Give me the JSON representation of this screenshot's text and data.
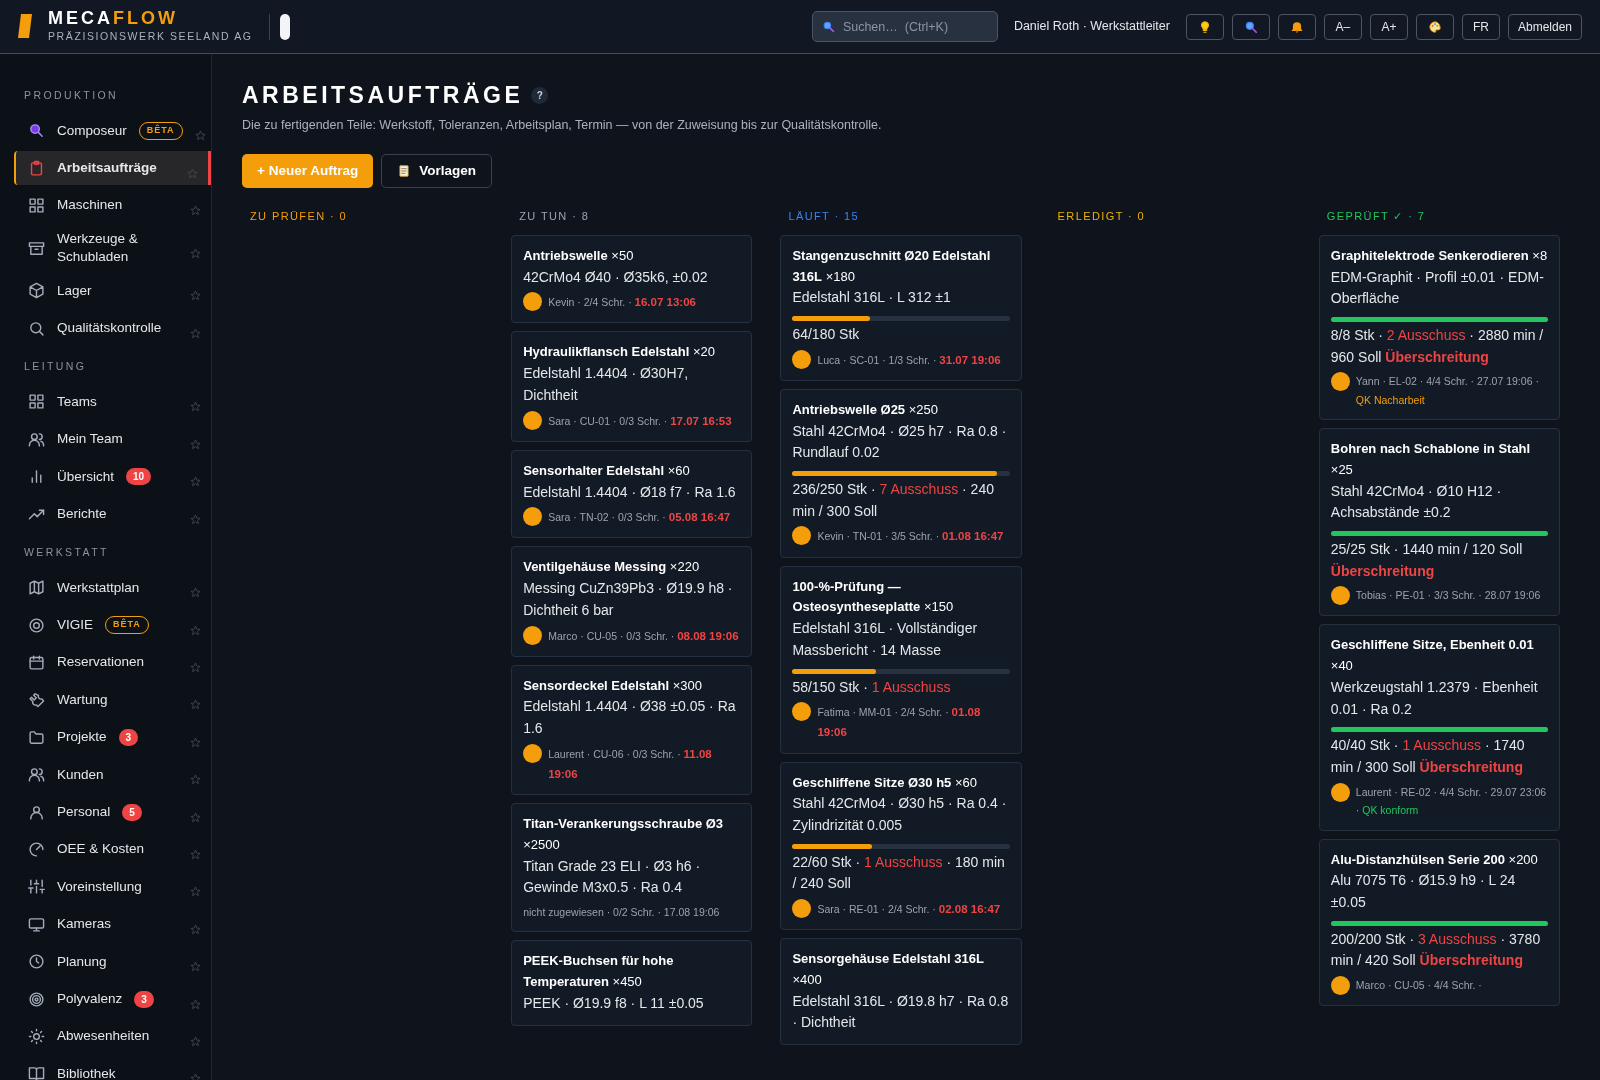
{
  "brand": {
    "first": "MECA",
    "second": "FLOW",
    "subtitle": "PRÄZISIONSWERK SEELAND AG"
  },
  "header": {
    "search": {
      "placeholder": "Suchen…  (Ctrl+K)"
    },
    "user": "Daniel Roth · Werkstattleiter",
    "text_buttons": [
      "A–",
      "A+",
      "FR",
      "Abmelden"
    ]
  },
  "sidebar": [
    {
      "title": "PRODUKTION",
      "items": [
        {
          "label": "Composeur",
          "selected": false,
          "badge": {
            "kind": "beta",
            "text": "BÊTA"
          }
        },
        {
          "label": "Arbeitsaufträge",
          "selected": true
        },
        {
          "label": "Maschinen",
          "selected": false
        },
        {
          "label": "Werkzeuge & Schubladen",
          "selected": false
        },
        {
          "label": "Lager",
          "selected": false
        },
        {
          "label": "Qualitätskontrolle",
          "selected": false
        }
      ]
    },
    {
      "title": "LEITUNG",
      "items": [
        {
          "label": "Teams",
          "selected": false
        },
        {
          "label": "Mein Team",
          "selected": false
        },
        {
          "label": "Übersicht",
          "selected": false,
          "badge": {
            "kind": "count",
            "text": "10"
          }
        },
        {
          "label": "Berichte",
          "selected": false
        }
      ]
    },
    {
      "title": "WERKSTATT",
      "items": [
        {
          "label": "Werkstattplan",
          "selected": false
        },
        {
          "label": "VIGIE",
          "selected": false,
          "badge": {
            "kind": "beta",
            "text": "BÊTA"
          }
        },
        {
          "label": "Reservationen",
          "selected": false
        },
        {
          "label": "Wartung",
          "selected": false
        },
        {
          "label": "Projekte",
          "selected": false,
          "badge": {
            "kind": "count",
            "text": "3"
          }
        },
        {
          "label": "Kunden",
          "selected": false
        },
        {
          "label": "Personal",
          "selected": false,
          "badge": {
            "kind": "count",
            "text": "5"
          }
        },
        {
          "label": "OEE & Kosten",
          "selected": false
        },
        {
          "label": "Voreinstellung",
          "selected": false
        },
        {
          "label": "Kameras",
          "selected": false
        },
        {
          "label": "Planung",
          "selected": false
        },
        {
          "label": "Polyvalenz",
          "selected": false,
          "badge": {
            "kind": "count",
            "text": "3"
          }
        },
        {
          "label": "Abwesenheiten",
          "selected": false
        },
        {
          "label": "Bibliothek",
          "selected": false
        }
      ]
    }
  ],
  "page": {
    "title": "ARBEITSAUFTRÄGE",
    "help": "?",
    "subtitle": "Die zu fertigenden Teile: Werkstoff, Toleranzen, Arbeitsplan, Termin — von der Zuweisung bis zur Qualitätskontrolle.",
    "primary_button": "+ Neuer Auftrag",
    "secondary_button": "Vorlagen"
  },
  "columns": [
    {
      "label": "ZU PRÜFEN · 0",
      "color": "#f59e0b"
    },
    {
      "label": "ZU TUN · 8",
      "color": "#9ca3af",
      "cards": [
        {
          "title": "**Antriebswelle** ×50",
          "spec": "42CrMo4 Ø40 · Ø35k6, ±0.02",
          "assigned": true,
          "meta": [
            {
              "kind": "plain",
              "text": "Kevin · 2/4 Schr. · "
            },
            {
              "kind": "overdue",
              "text": "16.07 13:06"
            }
          ]
        },
        {
          "title": "**Hydraulikflansch Edelstahl** ×20",
          "spec": "Edelstahl 1.4404 · Ø30H7, Dichtheit",
          "assigned": true,
          "meta": [
            {
              "kind": "plain",
              "text": "Sara · CU-01 · 0/3 Schr. · "
            },
            {
              "kind": "overdue",
              "text": "17.07 16:53"
            }
          ]
        },
        {
          "title": "**Sensorhalter Edelstahl** ×60",
          "spec": "Edelstahl 1.4404 · Ø18 f7 · Ra 1.6",
          "assigned": true,
          "meta": [
            {
              "kind": "plain",
              "text": "Sara · TN-02 · 0/3 Schr. · "
            },
            {
              "kind": "overdue",
              "text": "05.08 16:47"
            }
          ]
        },
        {
          "title": "**Ventilgehäuse Messing** ×220",
          "spec": "Messing CuZn39Pb3 · Ø19.9 h8 · Dichtheit 6 bar",
          "assigned": true,
          "meta": [
            {
              "kind": "plain",
              "text": "Marco · CU-05 · 0/3 Schr. · "
            },
            {
              "kind": "overdue",
              "text": "08.08 19:06"
            }
          ]
        },
        {
          "title": "**Sensordeckel Edelstahl** ×300",
          "spec": "Edelstahl 1.4404 · Ø38 ±0.05 · Ra 1.6",
          "assigned": true,
          "meta": [
            {
              "kind": "plain",
              "text": "Laurent · CU-06 · 0/3 Schr. · "
            },
            {
              "kind": "overdue",
              "text": "11.08 19:06"
            }
          ]
        },
        {
          "title": "**Titan-Verankerungsschraube Ø3** ×2500",
          "spec": "Titan Grade 23 ELI · Ø3 h6 · Gewinde M3x0.5 · Ra 0.4",
          "assigned": false,
          "meta": [
            {
              "kind": "plain",
              "text": "nicht zugewiesen · 0/2 Schr. · "
            },
            {
              "kind": "date",
              "text": "17.08 19:06"
            }
          ]
        },
        {
          "title": "**PEEK-Buchsen für hohe Temperaturen** ×450",
          "spec": "PEEK · Ø19.9 f8 · L 11 ±0.05"
        }
      ]
    },
    {
      "label": "LÄUFT · 15",
      "color": "#3b82f6",
      "cards": [
        {
          "title": "**Stangenzuschnitt Ø20 Edelstahl 316L** ×180",
          "spec": "Edelstahl 316L · L 312 ±1",
          "progress": {
            "level": 0.356,
            "done": false
          },
          "stats": [
            {
              "kind": "plain",
              "text": "64/180 Stk"
            }
          ],
          "assigned": true,
          "meta": [
            {
              "kind": "plain",
              "text": "Luca · SC-01 · 1/3 Schr. · "
            },
            {
              "kind": "overdue",
              "text": "31.07 19:06"
            }
          ]
        },
        {
          "title": "**Antriebswelle Ø25** ×250",
          "spec": "Stahl 42CrMo4 · Ø25 h7 · Ra 0.8 · Rundlauf 0.02",
          "progress": {
            "level": 0.944,
            "done": false
          },
          "stats": [
            {
              "kind": "plain",
              "text": "236/250 Stk · "
            },
            {
              "kind": "scrap",
              "text": "7 Ausschuss"
            },
            {
              "kind": "plain",
              "text": " · 240 min / 300 Soll"
            }
          ],
          "assigned": true,
          "meta": [
            {
              "kind": "plain",
              "text": "Kevin · TN-01 · 3/5 Schr. · "
            },
            {
              "kind": "overdue",
              "text": "01.08 16:47"
            }
          ]
        },
        {
          "title": "**100-%-Prüfung — Osteosyntheseplatte** ×150",
          "spec": "Edelstahl 316L · Vollständiger Massbericht · 14 Masse",
          "progress": {
            "level": 0.387,
            "done": false
          },
          "stats": [
            {
              "kind": "plain",
              "text": "58/150 Stk · "
            },
            {
              "kind": "scrap",
              "text": "1 Ausschuss"
            }
          ],
          "assigned": true,
          "meta": [
            {
              "kind": "plain",
              "text": "Fatima · MM-01 · 2/4 Schr. · "
            },
            {
              "kind": "overdue",
              "text": "01.08 19:06"
            }
          ]
        },
        {
          "title": "**Geschliffene Sitze Ø30 h5** ×60",
          "spec": "Stahl 42CrMo4 · Ø30 h5 · Ra 0.4 · Zylindrizität 0.005",
          "progress": {
            "level": 0.367,
            "done": false
          },
          "stats": [
            {
              "kind": "plain",
              "text": "22/60 Stk · "
            },
            {
              "kind": "scrap",
              "text": "1 Ausschuss"
            },
            {
              "kind": "plain",
              "text": " · 180 min / 240 Soll"
            }
          ],
          "assigned": true,
          "meta": [
            {
              "kind": "plain",
              "text": "Sara · RE-01 · 2/4 Schr. · "
            },
            {
              "kind": "overdue",
              "text": "02.08 16:47"
            }
          ]
        },
        {
          "title": "**Sensorgehäuse Edelstahl 316L** ×400",
          "spec": "Edelstahl 316L · Ø19.8 h7 · Ra 0.8 · Dichtheit"
        }
      ]
    },
    {
      "label": "ERLEDIGT · 0",
      "color": "#eab308"
    },
    {
      "label": "GEPRÜFT ✓ · 7",
      "color": "#22c55e",
      "cards": [
        {
          "title": "**Graphitelektrode Senkerodieren** ×8",
          "spec": "EDM-Graphit · Profil ±0.01 · EDM-Oberfläche",
          "progress": {
            "level": 1,
            "done": true
          },
          "stats": [
            {
              "kind": "plain",
              "text": "8/8 Stk · "
            },
            {
              "kind": "scrap",
              "text": "2 Ausschuss"
            },
            {
              "kind": "plain",
              "text": " · 2880 min / 960 Soll "
            },
            {
              "kind": "overrun",
              "text": "Überschreitung"
            }
          ],
          "assigned": true,
          "meta": [
            {
              "kind": "plain",
              "text": "Yann · EL-02 · 4/4 Schr. · "
            },
            {
              "kind": "date",
              "text": "27.07 19:06"
            },
            {
              "kind": "plain",
              "text": " · "
            },
            {
              "kind": "qk-rework",
              "text": "QK Nacharbeit"
            }
          ]
        },
        {
          "title": "**Bohren nach Schablone in Stahl** ×25",
          "spec": "Stahl 42CrMo4 · Ø10 H12 · Achsabstände ±0.2",
          "progress": {
            "level": 1,
            "done": true
          },
          "stats": [
            {
              "kind": "plain",
              "text": "25/25 Stk · 1440 min / 120 Soll "
            },
            {
              "kind": "overrun",
              "text": "Überschreitung"
            }
          ],
          "assigned": true,
          "meta": [
            {
              "kind": "plain",
              "text": "Tobias · PE-01 · 3/3 Schr. · "
            },
            {
              "kind": "date",
              "text": "28.07 19:06"
            }
          ]
        },
        {
          "title": "**Geschliffene Sitze, Ebenheit 0.01** ×40",
          "spec": "Werkzeugstahl 1.2379 · Ebenheit 0.01 · Ra 0.2",
          "progress": {
            "level": 1,
            "done": true
          },
          "stats": [
            {
              "kind": "plain",
              "text": "40/40 Stk · "
            },
            {
              "kind": "scrap",
              "text": "1 Ausschuss"
            },
            {
              "kind": "plain",
              "text": " · 1740 min / 300 Soll "
            },
            {
              "kind": "overrun",
              "text": "Überschreitung"
            }
          ],
          "assigned": true,
          "meta": [
            {
              "kind": "plain",
              "text": "Laurent · RE-02 · 4/4 Schr. · "
            },
            {
              "kind": "date",
              "text": "29.07 23:06"
            },
            {
              "kind": "plain",
              "text": " · "
            },
            {
              "kind": "qk-ok",
              "text": "QK konform"
            }
          ]
        },
        {
          "title": "**Alu-Distanzhülsen Serie 200** ×200",
          "spec": "Alu 7075 T6 · Ø15.9 h9 · L 24 ±0.05",
          "progress": {
            "level": 1,
            "done": true
          },
          "stats": [
            {
              "kind": "plain",
              "text": "200/200 Stk · "
            },
            {
              "kind": "scrap",
              "text": "3 Ausschuss"
            },
            {
              "kind": "plain",
              "text": " · 3780 min / 420 Soll "
            },
            {
              "kind": "overrun",
              "text": "Überschreitung"
            }
          ],
          "assigned": true,
          "meta": [
            {
              "kind": "plain",
              "text": "Marco · CU-05 · 4/4 Schr. ·"
            }
          ]
        }
      ]
    }
  ]
}
